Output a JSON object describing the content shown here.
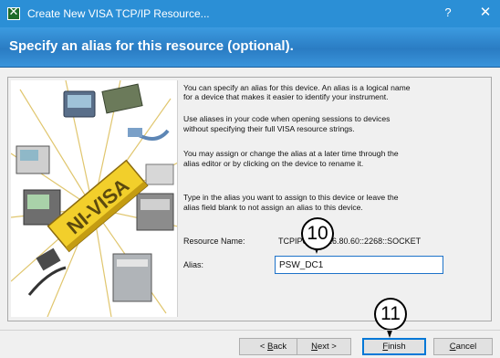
{
  "window": {
    "title": "Create New VISA TCP/IP Resource...",
    "help_glyph": "?",
    "close_glyph": "✕",
    "app_icon_glyph": "✕"
  },
  "header": {
    "title": "Specify an alias for this resource (optional)."
  },
  "illustration": {
    "logo_text": "NI-VISA"
  },
  "description": {
    "para1_line1": "You can specify an alias for this device. An alias is a logical name",
    "para1_line2": "for a device that makes it easier to identify your instrument.",
    "para2_line1": "Use aliases in your code when opening sessions to devices",
    "para2_line2": "without specifying their full VISA resource strings.",
    "para3_line1": "You may assign or change the alias at a later time through the",
    "para3_line2": "alias editor or by clicking on the device to rename it.",
    "para4_line1": "Type in the alias you want to assign to this device or leave the",
    "para4_line2": "alias field blank to not assign an alias to this device."
  },
  "form": {
    "resource_label": "Resource Name:",
    "resource_value": "TCPIP0::172.16.80.60::2268::SOCKET",
    "alias_label": "Alias:",
    "alias_value": "PSW_DC1"
  },
  "callouts": {
    "alias_step": "10",
    "finish_step": "11"
  },
  "buttons": {
    "back_mnemonic": "B",
    "back_rest": "ack",
    "back_prefix": "< ",
    "next_mnemonic": "N",
    "next_rest": "ext >",
    "finish_mnemonic": "F",
    "finish_rest": "inish",
    "cancel_mnemonic": "C",
    "cancel_rest": "ancel"
  },
  "colors": {
    "titlebar": "#2b8fd6",
    "header": "#2a7cc3",
    "input_border": "#1e73c9",
    "default_button_border": "#0078d7"
  }
}
